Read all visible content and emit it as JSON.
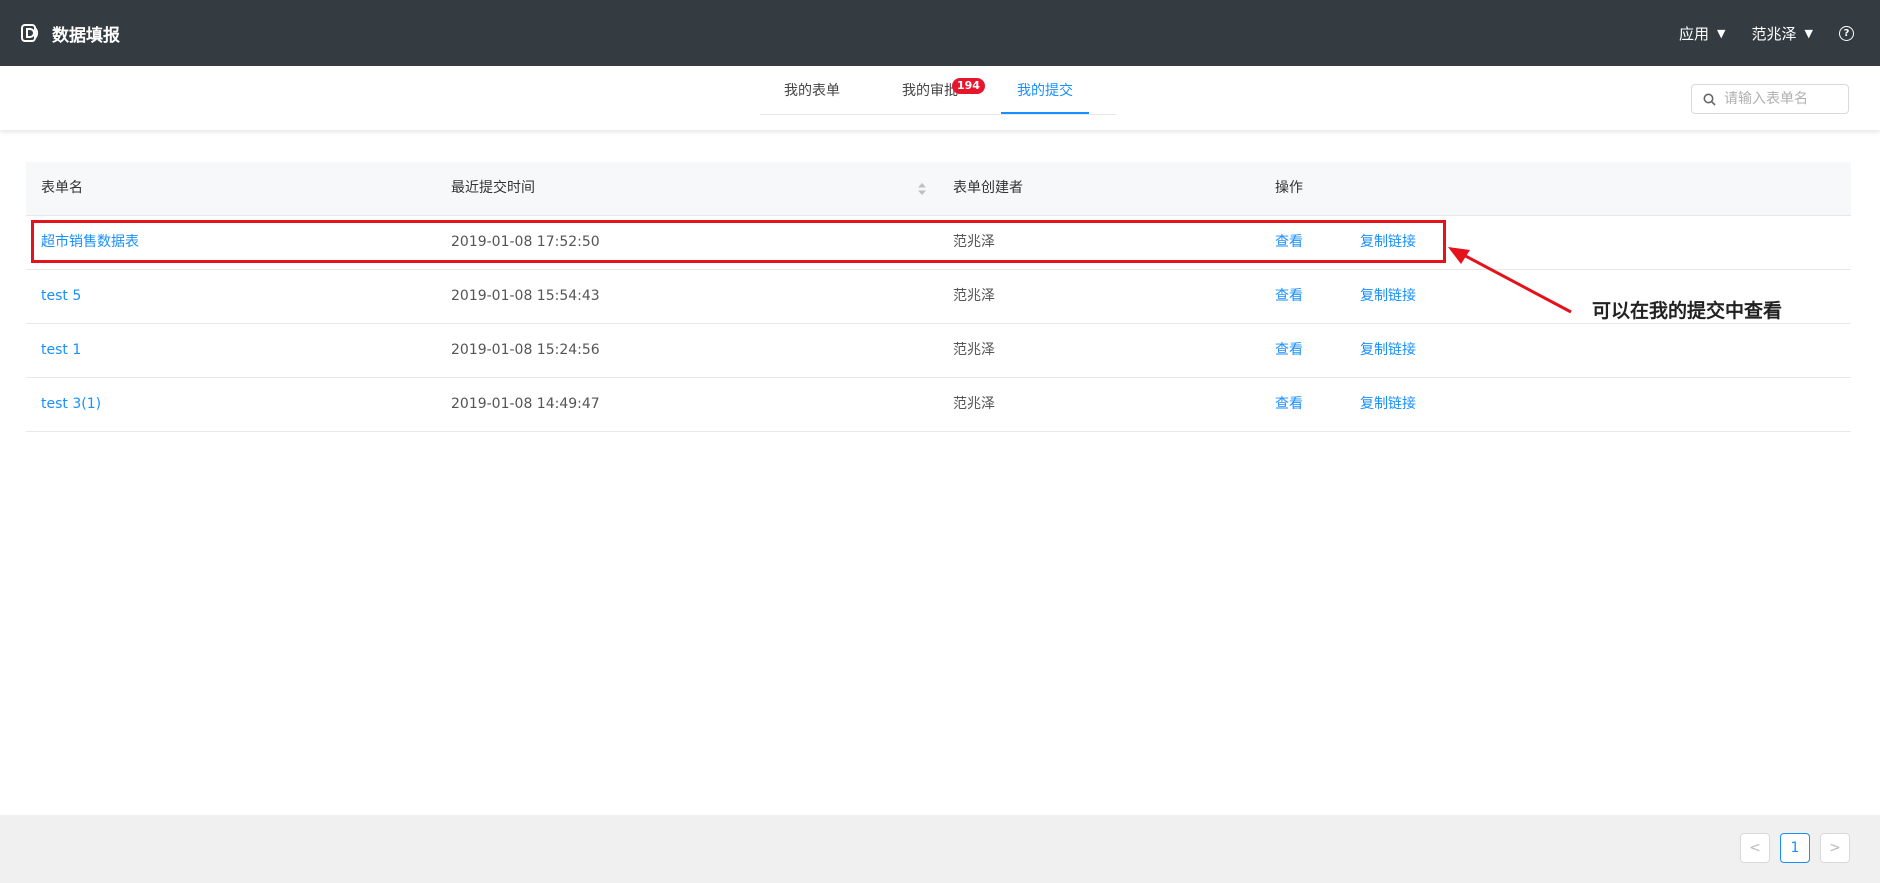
{
  "header": {
    "title": "数据填报",
    "apps_label": "应用",
    "user_label": "范兆泽",
    "help_glyph": "?"
  },
  "tabs": [
    {
      "label": "我的表单",
      "active": false
    },
    {
      "label": "我的审批",
      "active": false,
      "badge": "194"
    },
    {
      "label": "我的提交",
      "active": true
    }
  ],
  "search": {
    "placeholder": "请输入表单名"
  },
  "table": {
    "columns": [
      "表单名",
      "最近提交时间",
      "表单创建者",
      "操作"
    ],
    "rows": [
      {
        "name": "超市销售数据表",
        "time": "2019-01-08 17:52:50",
        "creator": "范兆泽",
        "view": "查看",
        "copy": "复制链接"
      },
      {
        "name": "test 5",
        "time": "2019-01-08 15:54:43",
        "creator": "范兆泽",
        "view": "查看",
        "copy": "复制链接"
      },
      {
        "name": "test 1",
        "time": "2019-01-08 15:24:56",
        "creator": "范兆泽",
        "view": "查看",
        "copy": "复制链接"
      },
      {
        "name": "test 3(1)",
        "time": "2019-01-08 14:49:47",
        "creator": "范兆泽",
        "view": "查看",
        "copy": "复制链接"
      }
    ]
  },
  "annotation": {
    "text": "可以在我的提交中查看",
    "color": "#e3121b"
  },
  "pagination": {
    "prev": "<",
    "current": "1",
    "next": ">"
  },
  "colors": {
    "header_bg": "#343c42",
    "accent": "#1890ff",
    "badge": "#e6162d"
  }
}
